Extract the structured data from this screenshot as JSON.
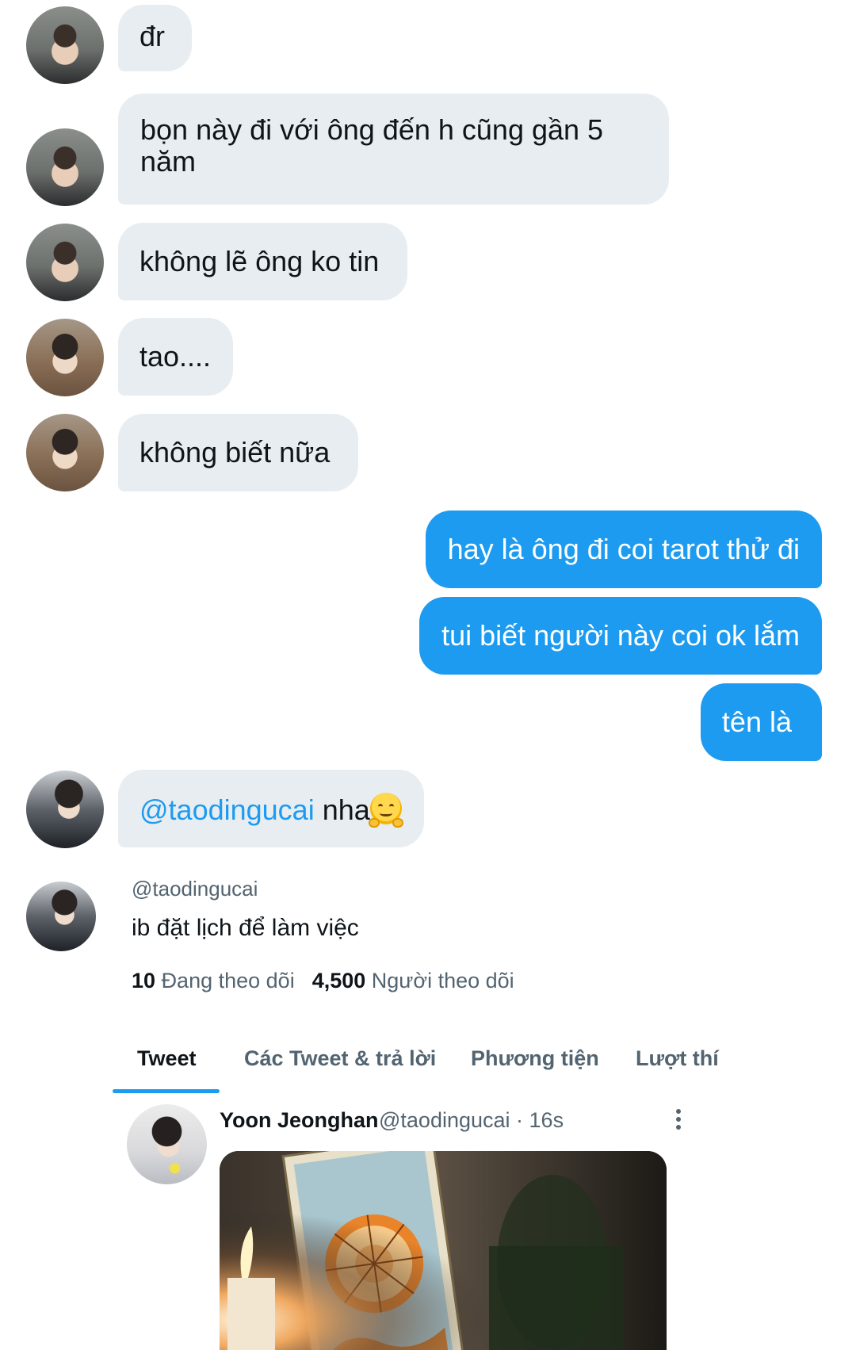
{
  "messages": [
    {
      "from": "other",
      "avatar": "avatar-dark-hair-drink",
      "text": "đr"
    },
    {
      "from": "other",
      "avatar": "avatar-dark-hair-drink",
      "text_lines": [
        "bọn này đi với ông đến h cũng gần 5",
        "năm"
      ]
    },
    {
      "from": "other",
      "avatar": "avatar-dark-hair-drink",
      "text": "không lẽ ông ko tin"
    },
    {
      "from": "other",
      "avatar": "avatar-headphones",
      "text": "tao...."
    },
    {
      "from": "other",
      "avatar": "avatar-headphones",
      "text": "không biết nữa"
    },
    {
      "from": "me",
      "text": "hay là ông đi coi tarot thử đi"
    },
    {
      "from": "me",
      "text": "tui biết người này coi ok lắm"
    },
    {
      "from": "me",
      "text": "tên là"
    },
    {
      "from": "other",
      "avatar": "avatar-snow-jacket",
      "mention": "@taodingucai",
      "text": " nha",
      "emoji": "hugging-face-emoji"
    }
  ],
  "profile": {
    "handle": "@taodingucai",
    "bio": "ib đặt lịch để làm việc",
    "following_count": "10",
    "following_label": "Đang theo dõi",
    "followers_count": "4,500",
    "followers_label": "Người theo dõi"
  },
  "tabs": [
    {
      "label": "Tweet",
      "active": true
    },
    {
      "label": "Các Tweet & trả lời",
      "active": false
    },
    {
      "label": "Phương tiện",
      "active": false
    },
    {
      "label": "Lượt thí",
      "active": false
    }
  ],
  "tweet": {
    "name": "Yoon Jeonghan",
    "handle": "@taodingucai",
    "time": "· 16s",
    "media": "tarot-card-wheel-of-fortune-photo"
  },
  "colors": {
    "accent": "#1d9bf0",
    "bubble_in": "#e8edf1",
    "text_primary": "#0f1419",
    "text_secondary": "#536471"
  }
}
